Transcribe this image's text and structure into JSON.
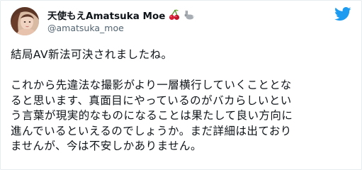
{
  "user": {
    "display_name": "天使もえAmatsuka Moe",
    "handle": "@amatsuka_moe",
    "name_emojis": [
      "cherries-emoji",
      "rabbit-emoji"
    ]
  },
  "platform": {
    "logo": "twitter-bird-icon",
    "brand_color": "#1d9bf0"
  },
  "tweet": {
    "paragraph1": [
      "結局AV新法可決されましたね。"
    ],
    "paragraph2": [
      "これから先違法な撮影がより一層横行していくこととな",
      "ると思います、真面目にやっているのがバカらしいとい",
      "う言葉が現実的なものになることは果たして良い方向に",
      "進んでいるといえるのでしょうか。まだ詳細は出ており",
      "ませんが、今は不安しかありません。"
    ]
  }
}
